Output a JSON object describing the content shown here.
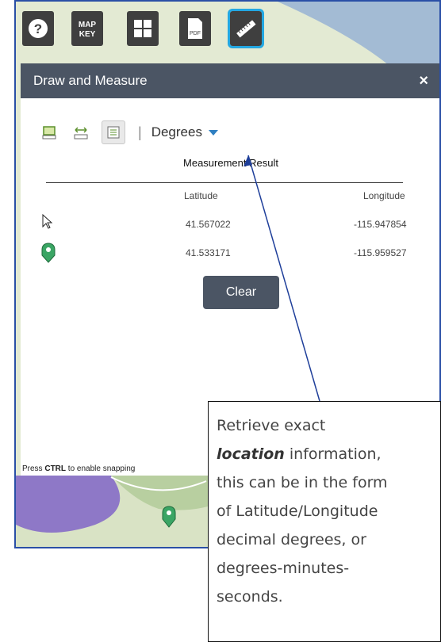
{
  "toolbar": {
    "buttons": [
      {
        "name": "help-icon",
        "label": ""
      },
      {
        "name": "map-key-icon",
        "label": "MAP\nKEY"
      },
      {
        "name": "grid-icon",
        "label": ""
      },
      {
        "name": "pdf-icon",
        "label": "PDF"
      },
      {
        "name": "ruler-icon",
        "label": ""
      }
    ]
  },
  "panel": {
    "title": "Draw and Measure",
    "close_label": "×",
    "unit_selected": "Degrees",
    "separator": "|",
    "result_title": "Measurement Result",
    "columns": [
      "Latitude",
      "Longitude"
    ],
    "rows": [
      {
        "icon": "cursor-icon",
        "latitude": "41.567022",
        "longitude": "-115.947854"
      },
      {
        "icon": "map-pin-icon",
        "latitude": "41.533171",
        "longitude": "-115.959527"
      }
    ],
    "clear_label": "Clear",
    "snap_hint_prefix": "Press ",
    "snap_hint_key": "CTRL",
    "snap_hint_suffix": " to enable snapping"
  },
  "callout": {
    "line1": "Retrieve exact",
    "emphasis": "location",
    "line2_rest": " information,",
    "line3": "this can be in the form",
    "line4": "of Latitude/Longitude",
    "line5": "decimal degrees, or",
    "line6": "degrees-minutes-",
    "line7": "seconds."
  },
  "colors": {
    "header_bg": "#4b5564",
    "accent_blue": "#23a7e2",
    "pin_green": "#3aa564",
    "frame_border": "#2a4fa6"
  }
}
